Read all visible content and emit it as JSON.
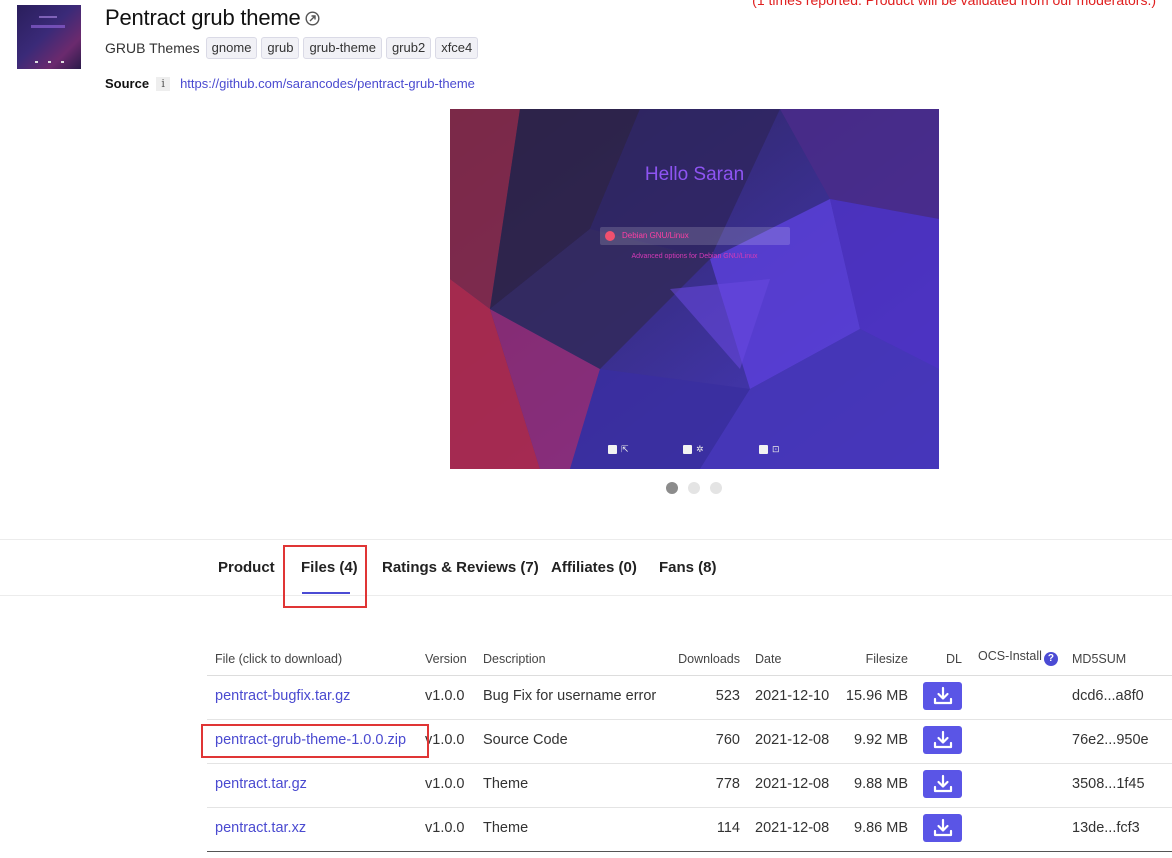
{
  "notice": "(1 times reported. Product will be validated from our moderators.)",
  "product": {
    "title": "Pentract grub theme",
    "category": "GRUB Themes",
    "tags": [
      "gnome",
      "grub",
      "grub-theme",
      "grub2",
      "xfce4"
    ],
    "source_label": "Source",
    "source_url": "https://github.com/sarancodes/pentract-grub-theme"
  },
  "screenshot": {
    "heading": "Hello Saran",
    "entry": "Debian GNU/Linux",
    "entry2": "Advanced options for Debian GNU/Linux",
    "slides": 3,
    "active_slide": 1
  },
  "tabs": [
    {
      "label": "Product"
    },
    {
      "label": "Files (4)"
    },
    {
      "label": "Ratings & Reviews (7)"
    },
    {
      "label": "Affiliates (0)"
    },
    {
      "label": "Fans (8)"
    }
  ],
  "active_tab": "Files (4)",
  "files_table": {
    "headers": {
      "file": "File (click to download)",
      "version": "Version",
      "description": "Description",
      "downloads": "Downloads",
      "date": "Date",
      "filesize": "Filesize",
      "dl": "DL",
      "ocs": "OCS-Install",
      "md5": "MD5SUM"
    },
    "rows": [
      {
        "file": "pentract-bugfix.tar.gz",
        "version": "v1.0.0",
        "description": "Bug Fix for username error",
        "downloads": "523",
        "date": "2021-12-10",
        "filesize": "15.96 MB",
        "md5": "dcd6...a8f0"
      },
      {
        "file": "pentract-grub-theme-1.0.0.zip",
        "version": "v1.0.0",
        "description": "Source Code",
        "downloads": "760",
        "date": "2021-12-08",
        "filesize": "9.92 MB",
        "md5": "76e2...950e"
      },
      {
        "file": "pentract.tar.gz",
        "version": "v1.0.0",
        "description": "Theme",
        "downloads": "778",
        "date": "2021-12-08",
        "filesize": "9.88 MB",
        "md5": "3508...1f45"
      },
      {
        "file": "pentract.tar.xz",
        "version": "v1.0.0",
        "description": "Theme",
        "downloads": "114",
        "date": "2021-12-08",
        "filesize": "9.86 MB",
        "md5": "13de...fcf3"
      }
    ]
  },
  "colors": {
    "accent": "#4b4bd4",
    "link": "#4a4ad0",
    "download_button": "#5a55e6",
    "highlight": "#e03535",
    "notice": "#e02020"
  },
  "icons": {
    "external": "external-link-icon",
    "info": "info-icon",
    "help": "help-icon",
    "download": "download-icon"
  }
}
